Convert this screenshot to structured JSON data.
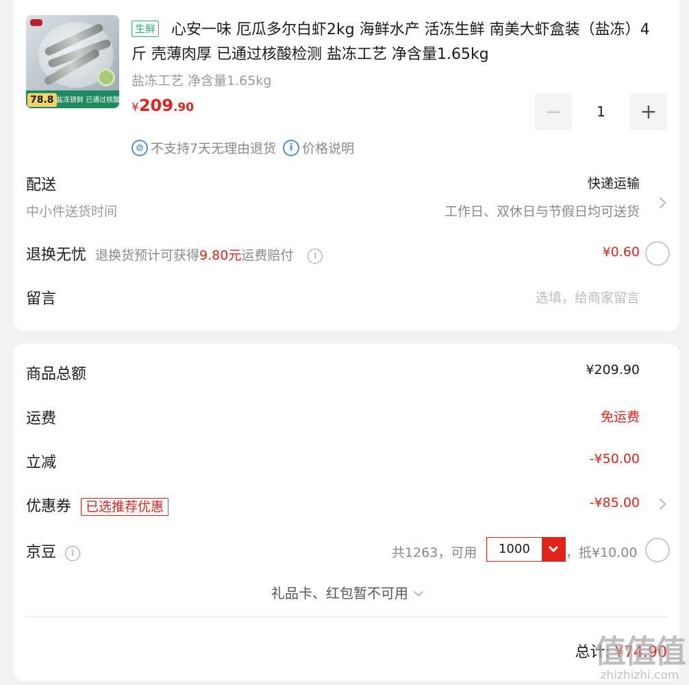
{
  "product": {
    "tag": "生鲜",
    "title": "心安一味 厄瓜多尔白虾2kg 海鲜水产 活冻生鲜 南美大虾盒装（盐冻）4斤 壳薄肉厚 已通过核酸检测 盐冻工艺 净含量1.65kg",
    "spec": "盐冻工艺 净含量1.65kg",
    "price_currency": "¥",
    "price_int": "209",
    "price_dec": ".90",
    "quantity": "1",
    "thumb_price": "78.8",
    "thumb_banner": "盐冻锁鲜 已通过核酸检测",
    "policy_no_return": "不支持7天无理由退货",
    "policy_price_info": "价格说明"
  },
  "delivery": {
    "label": "配送",
    "method": "快递运输",
    "sub_label": "中小件送货时间",
    "sub_value": "工作日、双休日与节假日均可送货"
  },
  "return_insurance": {
    "label": "退换无忧",
    "desc_prefix": "退换货预计可获得",
    "desc_amount": "9.80元",
    "desc_suffix": "运费赔付",
    "price": "¥0.60"
  },
  "message": {
    "label": "留言",
    "placeholder": "选填，给商家留言"
  },
  "summary": {
    "goods_total_label": "商品总额",
    "goods_total": "¥209.90",
    "shipping_label": "运费",
    "shipping": "免运费",
    "discount_label": "立减",
    "discount": "-¥50.00",
    "coupon_label": "优惠券",
    "coupon_tag": "已选推荐优惠",
    "coupon": "-¥85.00",
    "bean_label": "京豆",
    "bean_total": "共1263，可用",
    "bean_use": "1000",
    "bean_deduct": "，抵¥10.00",
    "giftcard": "礼品卡、红包暂不可用",
    "total_label": "总计:",
    "total": "¥74.90"
  },
  "watermark": {
    "glyph": "值值值",
    "site": "zhizhizhi.com"
  },
  "colors": {
    "accent_red": "#e2231a",
    "fresh_green": "#2bb673",
    "info_blue": "#4a90d9"
  }
}
